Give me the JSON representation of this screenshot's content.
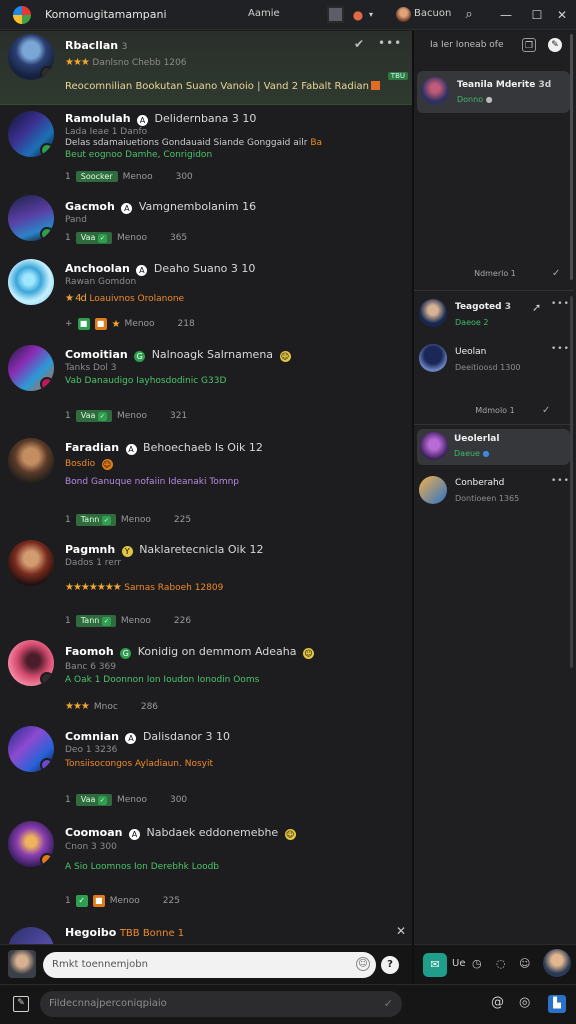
{
  "app": {
    "title": "Komomugitamampani",
    "mid_label": "Aamie",
    "user_name": "Bacuon"
  },
  "messages": [
    {
      "name": "Rbacllan",
      "num": "3",
      "sub": "Danlsno Chebb 1206",
      "text": "Reocomnilian Bookutan Suano Vanoio | Vand 2 Fabalt Radian",
      "hl_pill": "TBU"
    },
    {
      "name": "Ramolulah",
      "badge": "A",
      "title": "Delidernbana 3 10",
      "sub": "Lada Ieae 1 Danfo",
      "text": "Delas sdamaiuetions Gondauaid Siande Gonggaid ailr",
      "text_tail": "Ba",
      "text2": "Beut eognoo Damhe, Conrigidon",
      "chip": "Soocker",
      "meta": "Menoo",
      "count": "300"
    },
    {
      "name": "Gacmoh",
      "badge": "A",
      "title": "Vamgnembolanim 16",
      "sub": "Pand",
      "chip": "Vaa",
      "meta": "Menoo",
      "count": "365"
    },
    {
      "name": "Anchoolan",
      "badge": "A",
      "title": "Deaho Suano 3 10",
      "sub": "Rawan Gomdon",
      "text": "Loauivnos Orolanone",
      "meta": "Menoo",
      "count": "218"
    },
    {
      "name": "Comoitian",
      "badge": "G",
      "title": "Nalnoagk Salrnamena",
      "sub": "Tanks Dol 3",
      "text": "Vab Danaudigo Iayhosdodinic G33D",
      "chip": "Vaa",
      "meta": "Menoo",
      "count": "321"
    },
    {
      "name": "Faradian",
      "badge": "A",
      "title": "Behoechaeb Is Oik 12",
      "sub": "Bosdio",
      "text": "Bond Ganuque nofaiin Ideanaki Tomnp",
      "chip": "Tann",
      "meta": "Menoo",
      "count": "225"
    },
    {
      "name": "Pagmnh",
      "badge": "Y",
      "title": "Naklaretecnicla Oik 12",
      "sub": "Dados 1 rerr",
      "text": "Sarnas Raboeh 12809",
      "chip": "Tann",
      "meta": "Menoo",
      "count": "226"
    },
    {
      "name": "Faomoh",
      "badge": "G",
      "title": "Konidig on demmom Adeaha",
      "sub": "Banc 6 369",
      "text": "A Oak 1 Doonnon Ion Ioudon Ionodin Ooms",
      "meta": "Mnoc",
      "count": "286"
    },
    {
      "name": "Comnian",
      "badge": "A",
      "title": "Dalisdanor 3 10",
      "sub": "Deo 1 3236",
      "text": "Tonsiisocongos Ayladiaun. Nosyit",
      "chip": "Vaa",
      "meta": "Menoo",
      "count": "300"
    },
    {
      "name": "Coomoan",
      "badge": "A",
      "title": "Nabdaek eddonemebhe",
      "sub": "Cnon 3 300",
      "text": "A Sio Loomnos Ion Derebhk Loodb",
      "meta": "Menoo",
      "count": "225"
    },
    {
      "name": "Hegoibo",
      "title": "TBB Bonne 1"
    }
  ],
  "left_input": {
    "placeholder": "Rmkt toennemjobn"
  },
  "right_panel": {
    "header": "Ia Ier Ioneab ofe",
    "cards": [
      {
        "name": "Teanila Mderite",
        "num": "3d",
        "sub": "Donno"
      },
      {
        "name": "Teagoted",
        "num": "3",
        "sub": "Daeoe 2"
      },
      {
        "name": "Ueolan",
        "sub": "Deeitioosd 1300"
      },
      {
        "name": "Ueolerlal",
        "sub": "Daeue"
      },
      {
        "name": "Conberahd",
        "sub": "Dontioeen 1365"
      }
    ],
    "sec1": "Ndmerlo 1",
    "sec2": "Mdmolo 1",
    "input_label": "Ue"
  },
  "bottom": {
    "placeholder": "Fildecnnajperconiqpiaio"
  },
  "colors": {
    "bg": "#1c1c1e",
    "accent_green": "#2e9e4f",
    "accent_orange": "#e07b1a",
    "teal": "#1f9e8c",
    "blue": "#2a72c9"
  }
}
